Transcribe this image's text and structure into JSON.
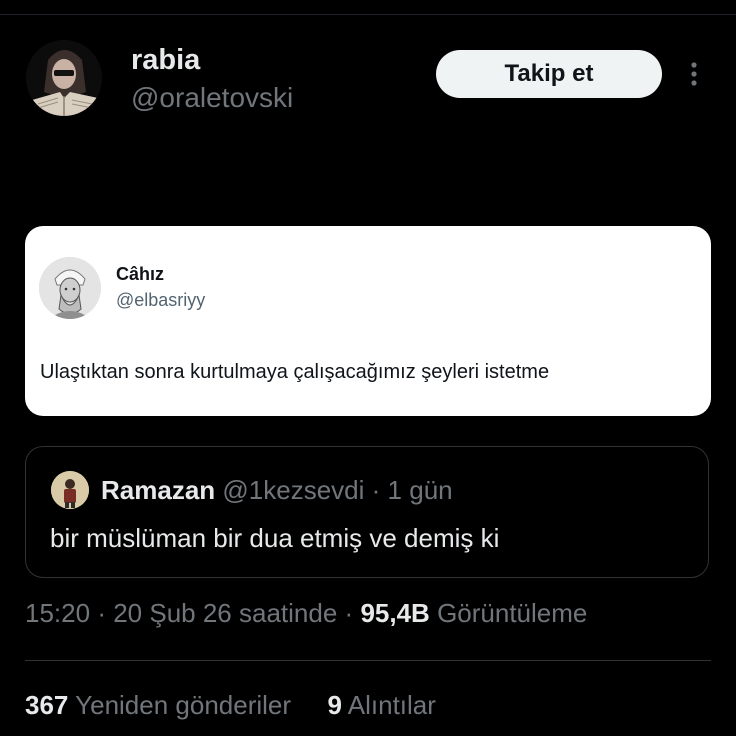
{
  "author": {
    "display_name": "rabia",
    "handle": "@oraletovski"
  },
  "actions": {
    "follow_label": "Takip et",
    "more_icon": "more-vertical-icon"
  },
  "embedded_image": {
    "name": "Câhız",
    "handle": "@elbasriyy",
    "text": "Ulaştıktan sonra kurtulmaya çalışacağımız şeyleri istetme"
  },
  "quoted_tweet": {
    "name": "Ramazan",
    "handle": "@1kezsevdi",
    "separator": "·",
    "time": "1 gün",
    "text": "bir müslüman bir dua etmiş ve demiş ki"
  },
  "meta": {
    "time": "15:20",
    "sep1": "·",
    "date": "20 Şub 26 saatinde",
    "sep2": "·",
    "views_count": "95,4B",
    "views_label": "Görüntüleme"
  },
  "stats": {
    "reposts_count": "367",
    "reposts_label": "Yeniden gönderiler",
    "quotes_count": "9",
    "quotes_label": "Alıntılar"
  },
  "colors": {
    "background": "#000000",
    "text_primary": "#e7e9ea",
    "text_secondary": "#71767b",
    "border": "#2f3336",
    "button_bg": "#eff3f4"
  }
}
